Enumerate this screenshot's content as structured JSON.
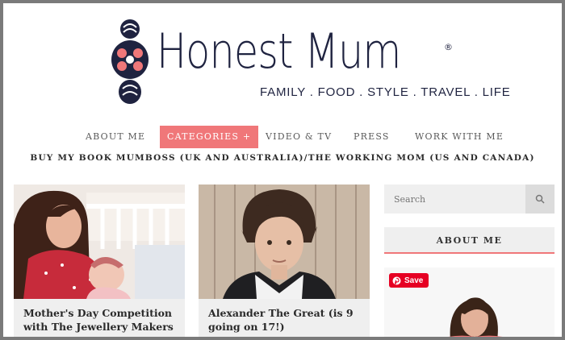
{
  "logo": {
    "title": "Honest Mum",
    "reg": "®",
    "tagline": "FAMILY . FOOD . STYLE . TRAVEL . LIFE"
  },
  "nav": {
    "items": [
      {
        "label": "ABOUT ME"
      },
      {
        "label": "CATEGORIES +"
      },
      {
        "label": "VIDEO & TV"
      },
      {
        "label": "PRESS"
      },
      {
        "label": "WORK WITH ME"
      }
    ],
    "sub_link": "BUY MY BOOK MUMBOSS (UK AND AUSTRALIA)/THE WORKING MOM (US AND CANADA)"
  },
  "posts": [
    {
      "title": "Mother's Day Competition with The Jewellery Makers"
    },
    {
      "title": "Alexander The Great (is 9 going on 17!)"
    }
  ],
  "sidebar": {
    "search_placeholder": "Search",
    "about_heading": "ABOUT ME",
    "save_label": "Save"
  },
  "colors": {
    "accent": "#f07779",
    "navy": "#1f2340",
    "pinterest": "#e60023"
  }
}
